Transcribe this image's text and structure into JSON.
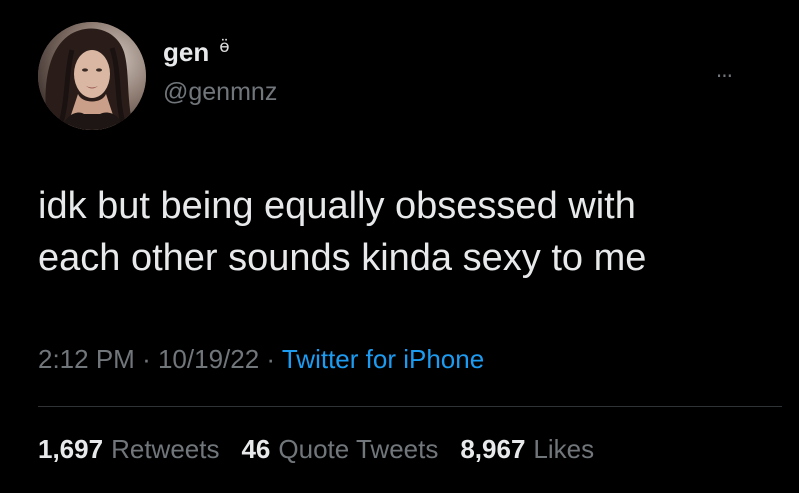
{
  "user": {
    "display_name": "gen",
    "name_emoji": "ӫ",
    "handle": "@genmnz",
    "avatar_icon": "profile-photo"
  },
  "header": {
    "more_icon": "more-horizontal-icon",
    "more_label": "···"
  },
  "tweet": {
    "text_line_1": "idk but being equally obsessed with",
    "text_line_2": "each other sounds kinda sexy to me"
  },
  "meta": {
    "time": "2:12 PM",
    "separator_1": "·",
    "date": "10/19/22",
    "separator_2": "·",
    "source": "Twitter for iPhone"
  },
  "stats": {
    "retweets_count": "1,697",
    "retweets_label": "Retweets",
    "quotes_count": "46",
    "quotes_label": "Quote Tweets",
    "likes_count": "8,967",
    "likes_label": "Likes"
  },
  "colors": {
    "background": "#000000",
    "text_primary": "#e7e9ea",
    "text_secondary": "#71767b",
    "accent": "#1d9bf0",
    "divider": "#2f3336"
  }
}
